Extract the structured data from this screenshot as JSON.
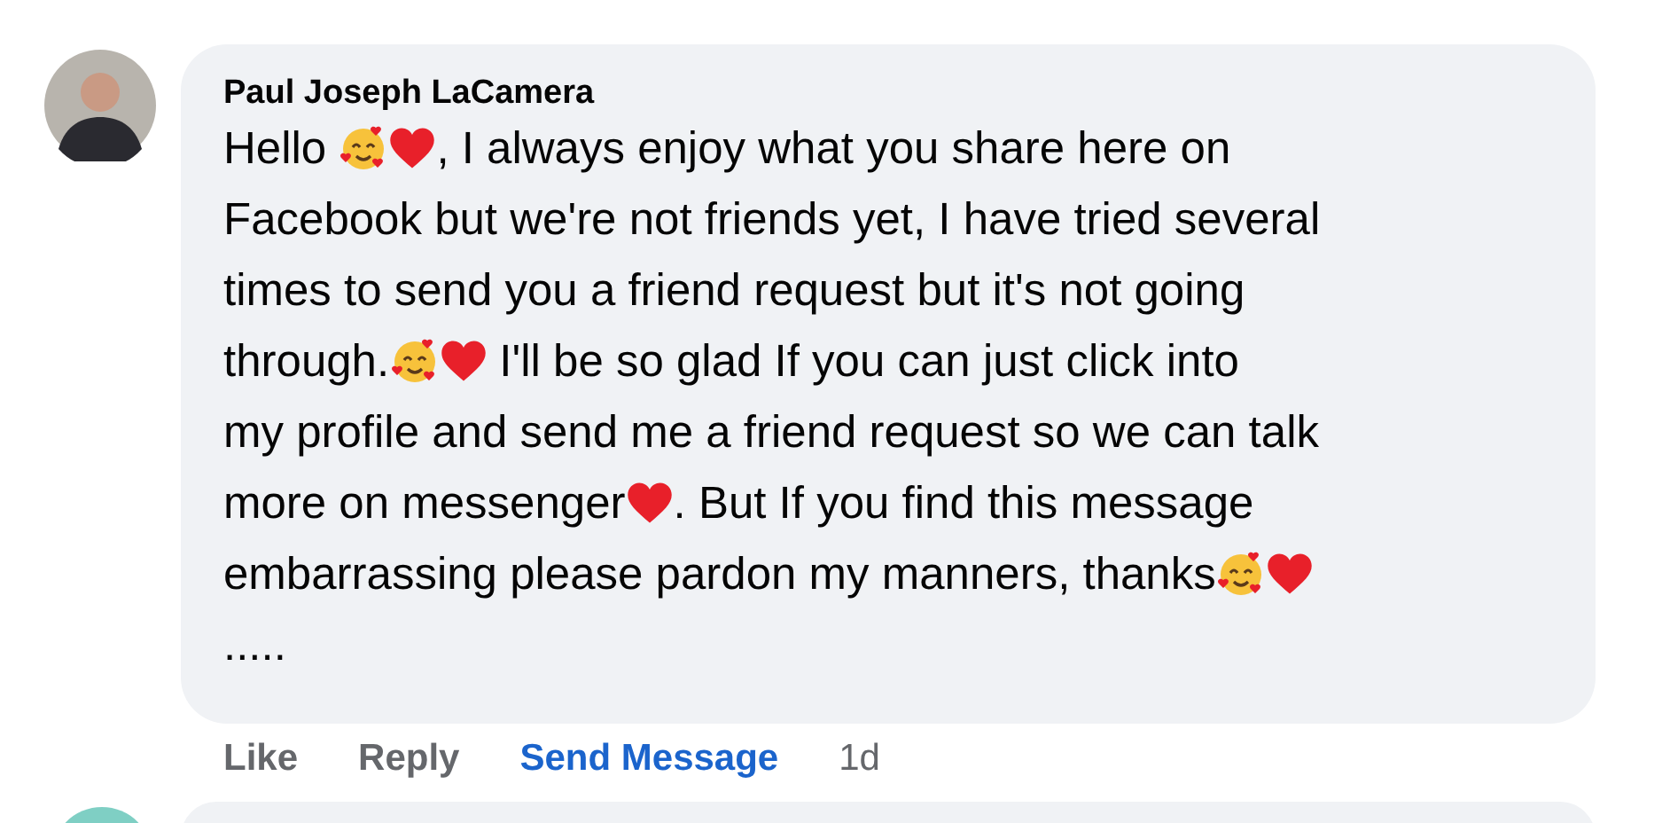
{
  "comment": {
    "author": "Paul Joseph LaCamera",
    "lines": [
      [
        {
          "kind": "text",
          "text": "Hello "
        },
        {
          "kind": "smile_hearts"
        },
        {
          "kind": "heart"
        },
        {
          "kind": "text",
          "text": ", I always enjoy what you share here on"
        }
      ],
      [
        {
          "kind": "text",
          "text": "Facebook but we're not friends yet, I have tried several"
        }
      ],
      [
        {
          "kind": "text",
          "text": "times to send you a friend request but it's not going"
        }
      ],
      [
        {
          "kind": "text",
          "text": "through."
        },
        {
          "kind": "smile_hearts"
        },
        {
          "kind": "heart"
        },
        {
          "kind": "text",
          "text": " I'll be so glad If you can just click into"
        }
      ],
      [
        {
          "kind": "text",
          "text": "my profile and send me a friend request so we can talk"
        }
      ],
      [
        {
          "kind": "text",
          "text": "more on messenger"
        },
        {
          "kind": "heart"
        },
        {
          "kind": "text",
          "text": ". But If you find this message"
        }
      ],
      [
        {
          "kind": "text",
          "text": "embarrassing please pardon my manners, thanks"
        },
        {
          "kind": "smile_hearts"
        },
        {
          "kind": "heart"
        }
      ],
      [
        {
          "kind": "text",
          "text": "....."
        }
      ]
    ],
    "actions": [
      {
        "label": "Like",
        "kind": "plain"
      },
      {
        "label": "Reply",
        "kind": "plain"
      },
      {
        "label": "Send Message",
        "kind": "link"
      }
    ],
    "time": "1d"
  }
}
